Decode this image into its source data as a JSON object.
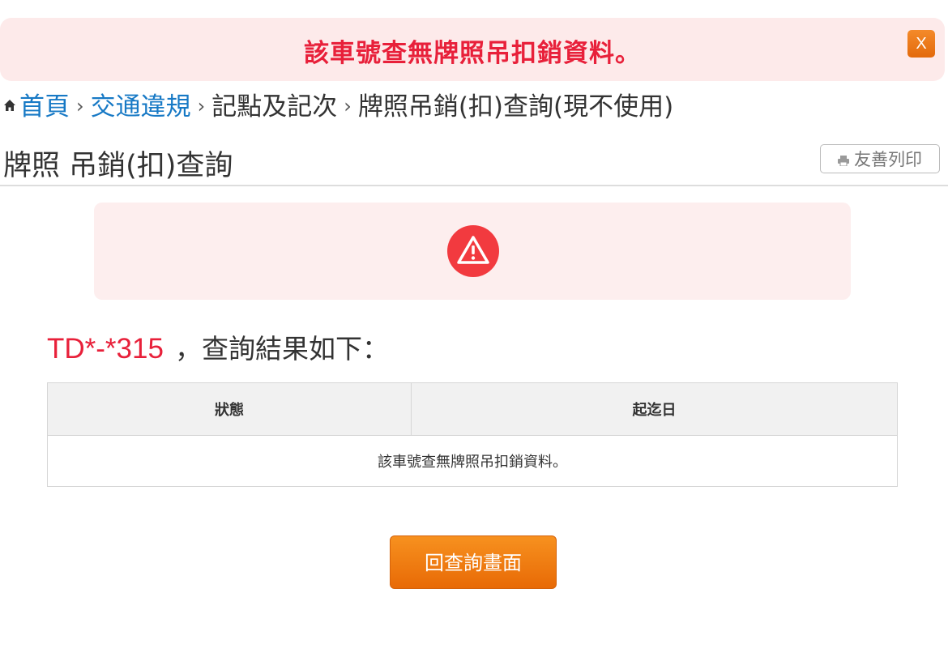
{
  "alert": {
    "message": "該車號查無牌照吊扣銷資料。",
    "close_label": "X"
  },
  "breadcrumb": {
    "items": [
      "首頁",
      "交通違規",
      "記點及記次",
      "牌照吊銷(扣)查詢(現不使用)"
    ],
    "separator": "›"
  },
  "page": {
    "title": "牌照 吊銷(扣)查詢",
    "print_label": "友善列印"
  },
  "result": {
    "plate": "TD*-*315",
    "suffix": "，查詢結果如下："
  },
  "table": {
    "columns": [
      "狀態",
      "起迄日"
    ],
    "empty_message": "該車號查無牌照吊扣銷資料。"
  },
  "actions": {
    "back_label": "回查詢畫面"
  },
  "colors": {
    "alert_text": "#e8203a",
    "alert_bg": "#fdeaea",
    "link": "#1779c5",
    "button_orange": "#f7911f",
    "warning_icon": "#f23a3f"
  },
  "icons": {
    "home": "home-icon",
    "printer": "printer-icon",
    "warning": "warning-triangle-icon"
  }
}
